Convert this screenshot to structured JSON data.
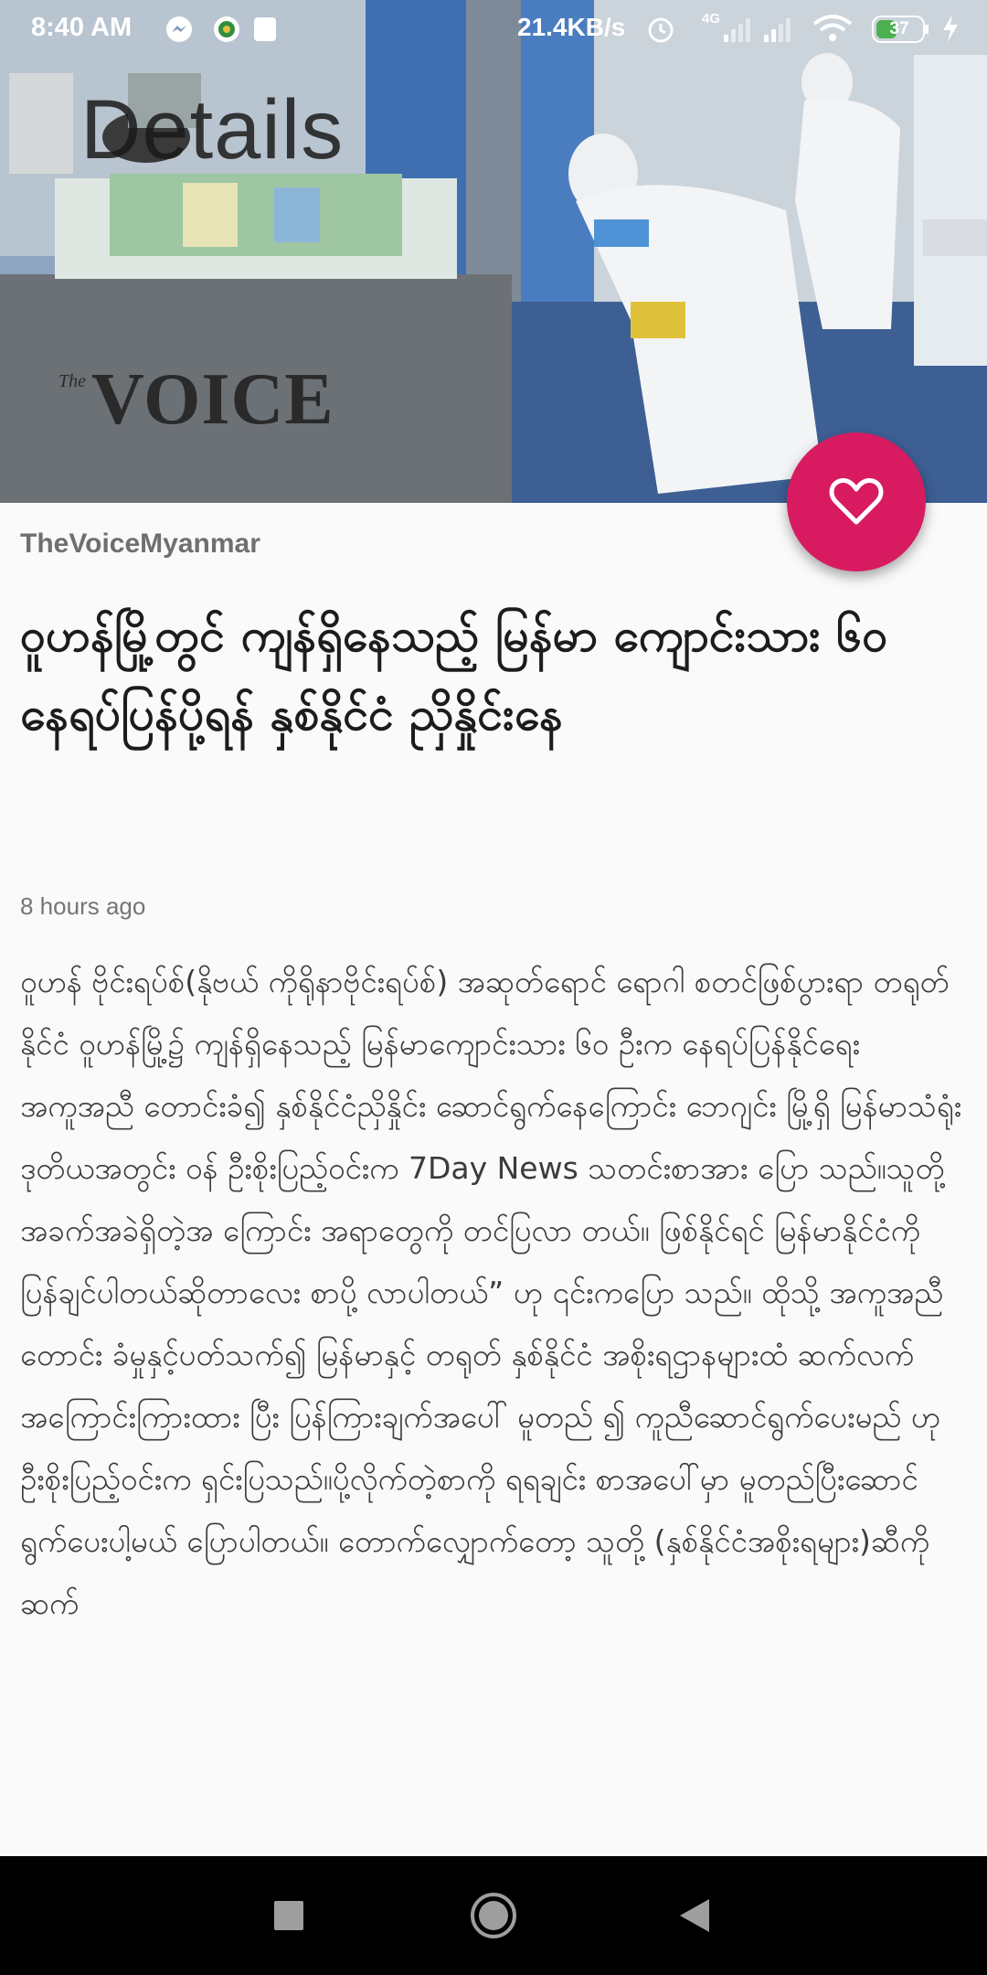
{
  "status_bar": {
    "time": "8:40 AM",
    "net_speed": "21.4KB/s",
    "network_type": "4G",
    "battery_level": "37",
    "icons": [
      "messenger-icon",
      "app-notification-icon",
      "alarm-icon",
      "signal-icon",
      "wifi-icon",
      "battery-icon",
      "charging-icon"
    ]
  },
  "screen_title": "Details",
  "hero": {
    "logo_small": "The",
    "logo_main": "VOICE"
  },
  "favorite_button": {
    "icon": "heart-outline-icon",
    "color": "#d81b60"
  },
  "article": {
    "source": "TheVoiceMyanmar",
    "headline": "ဝူဟန်မြို့တွင် ကျန်ရှိနေသည့် မြန်မာ ကျောင်းသား ၆၀ နေရပ်ပြန်ပို့ရန် နှစ်နိုင်ငံ ညှိနှိုင်းနေ",
    "time_ago": "8 hours ago",
    "body": " ဝူဟန် ဗိုင်းရပ်စ်(နိုဗယ် ကိုရိုနာဗိုင်းရပ်စ်) အဆုတ်ရောင် ရောဂါ စတင်ဖြစ်ပွားရာ တရုတ် နိုင်ငံ ဝူဟန်မြို့၌ ကျန်ရှိနေသည့် မြန်မာကျောင်းသား ၆၀ ဦးက နေရပ်ပြန်နိုင်ရေး အကူအညီ တောင်းခံ၍ နှစ်နိုင်ငံညှိနှိုင်း ဆောင်ရွက်နေကြောင်း ဘေဂျင်း မြို့ရှိ မြန်မာသံရုံး ဒုတိယအတွင်း ဝန် ဦးစိုးပြည့်ဝင်းက 7Day News သတင်းစာအား ပြော သည်။သူတို့ အခက်အခဲရှိတဲ့အ ကြောင်း အရာတွေကို တင်ပြလာ တယ်။ ဖြစ်နိုင်ရင် မြန်မာနိုင်ငံကို ပြန်ချင်ပါတယ်ဆိုတာလေး စာပို့ လာပါတယ်” ဟု ၎င်းကပြော သည်။ ထိုသို့ အကူအညီတောင်း ခံမှုနှင့်ပတ်သက်၍ မြန်မာနှင့်  တရုတ် နှစ်နိုင်ငံ အစိုးရဌာနများထံ  ဆက်လက်အကြောင်းကြားထား ပြီး ပြန်ကြားချက်အပေါ် မူတည် ၍ ကူညီဆောင်ရွက်ပေးမည် ဟု  ဦးစိုးပြည့်ဝင်းက ရှင်းပြသည်။ပို့လိုက်တဲ့စာကို ရရချင်း  စာအပေါ်မှာ မူတည်ပြီးဆောင် ရွက်ပေးပါ့မယ် ပြောပါတယ်။ တောက်လျှောက်တော့ သူတို့ (နှစ်နိုင်ငံအစိုးရများ)ဆီကိုဆက်"
  },
  "nav_bar": {
    "buttons": [
      "recents-button",
      "home-button",
      "back-button"
    ]
  }
}
